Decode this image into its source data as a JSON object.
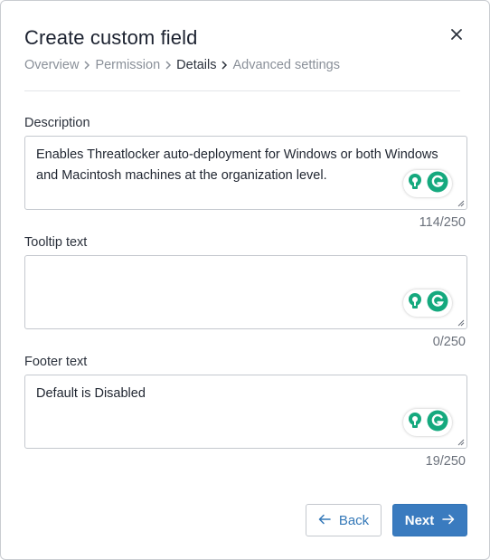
{
  "dialog": {
    "title": "Create custom field",
    "close_icon": "close-icon"
  },
  "breadcrumb": {
    "steps": [
      "Overview",
      "Permission",
      "Details",
      "Advanced settings"
    ],
    "active_index": 2
  },
  "fields": {
    "description": {
      "label": "Description",
      "value": "Enables Threatlocker auto-deployment for Windows or both Windows and Macintosh machines at the organization level.",
      "counter": "114/250"
    },
    "tooltip": {
      "label": "Tooltip text",
      "value": "",
      "counter": "0/250"
    },
    "footer": {
      "label": "Footer text",
      "value": "Default is Disabled",
      "counter": "19/250"
    }
  },
  "buttons": {
    "back_label": "Back",
    "next_label": "Next"
  },
  "colors": {
    "primary": "#3a7bbf",
    "grammarly_green": "#15a97e"
  }
}
